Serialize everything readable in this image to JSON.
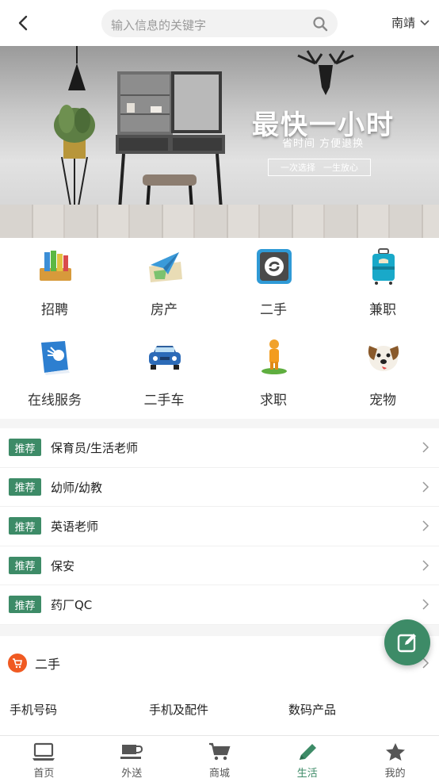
{
  "header": {
    "search_placeholder": "输入信息的关键字",
    "city": "南靖"
  },
  "banner": {
    "title": "最快一小时",
    "subtitle": "省时间 方便退换",
    "tag_left": "一次选择",
    "tag_right": "一生放心"
  },
  "categories": [
    {
      "label": "招聘",
      "icon": "books-icon"
    },
    {
      "label": "房产",
      "icon": "map-plane-icon"
    },
    {
      "label": "二手",
      "icon": "shazam-icon"
    },
    {
      "label": "兼职",
      "icon": "luggage-icon"
    },
    {
      "label": "在线服务",
      "icon": "blue-book-icon"
    },
    {
      "label": "二手车",
      "icon": "car-icon"
    },
    {
      "label": "求职",
      "icon": "person-pin-icon"
    },
    {
      "label": "宠物",
      "icon": "dog-icon"
    }
  ],
  "recommend": {
    "badge": "推荐",
    "items": [
      {
        "text": "保育员/生活老师"
      },
      {
        "text": "幼师/幼教"
      },
      {
        "text": "英语老师"
      },
      {
        "text": "保安"
      },
      {
        "text": "药厂QC"
      }
    ]
  },
  "secondhand": {
    "title": "二手",
    "links": [
      "手机号码",
      "手机及配件",
      "数码产品"
    ]
  },
  "nav": [
    {
      "label": "首页",
      "icon": "laptop-icon",
      "active": false
    },
    {
      "label": "外送",
      "icon": "coffee-icon",
      "active": false
    },
    {
      "label": "商城",
      "icon": "cart-icon",
      "active": false
    },
    {
      "label": "生活",
      "icon": "pencil-icon",
      "active": true
    },
    {
      "label": "我的",
      "icon": "star-icon",
      "active": false
    }
  ],
  "colors": {
    "accent": "#3d8b67",
    "cart_badge": "#f05a22"
  }
}
